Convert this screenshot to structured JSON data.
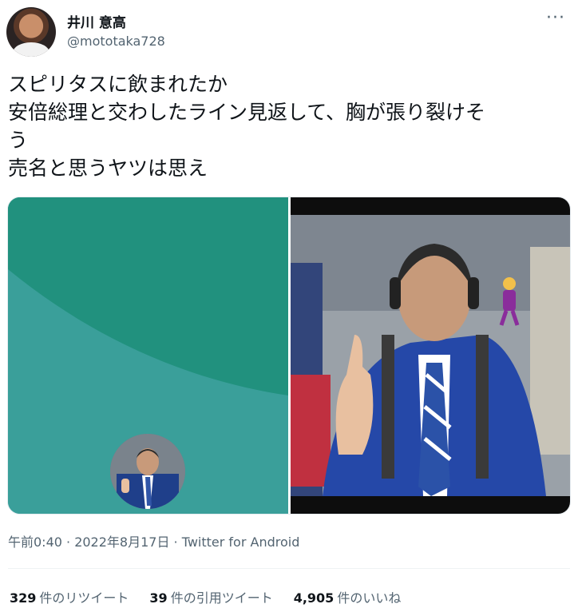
{
  "author": {
    "display_name": "井川 意高",
    "handle": "@mototaka728"
  },
  "tweet": {
    "lines": [
      "スピリタスに飲まれたか",
      "安倍総理と交わしたライン見返して、胸が張り裂けそ",
      "う",
      "売名と思うヤツは思え"
    ]
  },
  "meta": {
    "timestamp": "午前0:40 · 2022年8月17日 · Twitter for Android"
  },
  "stats": {
    "retweets_count": "329",
    "retweets_label": "件のリツイート",
    "quotes_count": "39",
    "quotes_label": "件の引用ツイート",
    "likes_count": "4,905",
    "likes_label": "件のいいね"
  },
  "icons": {
    "more": "more-options-icon"
  },
  "colors": {
    "teal_dark": "#21917e",
    "teal": "#3a9f9a",
    "muted_text": "#536471"
  }
}
